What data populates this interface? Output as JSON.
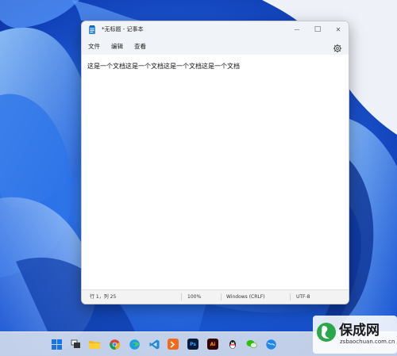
{
  "window": {
    "title": "*无标题 - 记事本",
    "minimize_glyph": "—",
    "maximize_glyph": "□",
    "close_glyph": "✕"
  },
  "menu": {
    "items": [
      "文件",
      "编辑",
      "查看"
    ]
  },
  "editor": {
    "content": "这是一个文档这是一个文档这是一个文档这是一个文档"
  },
  "statusbar": {
    "position": "行 1，列 25",
    "zoom": "100%",
    "line_ending": "Windows (CRLF)",
    "encoding": "UTF-8"
  },
  "taskbar": {
    "apps": [
      {
        "name": "start",
        "icon": "windows-logo-icon"
      },
      {
        "name": "taskview",
        "icon": "task-view-icon"
      },
      {
        "name": "explorer",
        "icon": "folder-icon"
      },
      {
        "name": "chrome",
        "icon": "chrome-icon"
      },
      {
        "name": "edge",
        "icon": "edge-icon"
      },
      {
        "name": "vscode",
        "icon": "vscode-icon"
      },
      {
        "name": "terminal",
        "icon": "terminal-icon"
      },
      {
        "name": "photoshop",
        "icon": "photoshop-icon",
        "label": "Ps"
      },
      {
        "name": "illustrator",
        "icon": "illustrator-icon",
        "label": "Ai"
      },
      {
        "name": "qq",
        "icon": "qq-icon"
      },
      {
        "name": "wechat",
        "icon": "wechat-icon"
      },
      {
        "name": "browser",
        "icon": "globe-icon"
      }
    ]
  },
  "watermark": {
    "title": "保成网",
    "url": "zsbaochuan.com.cn"
  },
  "colors": {
    "wallpaper_base": "#1a4fc8",
    "window_bg": "#f9f9f9",
    "chrome_bg": "#f0f3f7",
    "taskbar_bg": "#d0daec",
    "watermark_green": "#2aa84a"
  }
}
